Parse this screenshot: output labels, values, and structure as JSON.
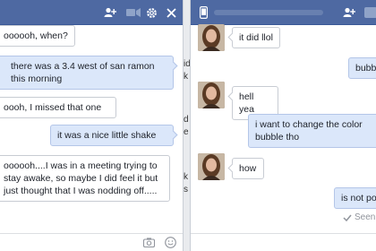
{
  "left_chat": {
    "messages": [
      {
        "side": "theirs",
        "text": "oooooh, when?"
      },
      {
        "side": "mine",
        "text": "there was a 3.4 west of san ramon this morning"
      },
      {
        "side": "theirs",
        "text": "oooh, I missed that one"
      },
      {
        "side": "mine",
        "text": "it was a nice little shake"
      },
      {
        "side": "theirs",
        "text": "oooooh....I was in a meeting trying to stay awake, so maybe I did feel it but just thought that I was nodding off....."
      }
    ]
  },
  "gap_text": [
    "id",
    "k",
    "d",
    "e",
    "k",
    "s"
  ],
  "right_chat": {
    "messages": [
      {
        "side": "theirs",
        "text": "it did llol"
      },
      {
        "side": "mine",
        "text": "bubb"
      },
      {
        "side": "theirs",
        "text": "hell yea"
      },
      {
        "side": "mine",
        "text": "i want to change the color bubble tho"
      },
      {
        "side": "theirs",
        "text": "how"
      },
      {
        "side": "mine",
        "text": "is not po"
      }
    ],
    "seen_label": "Seen"
  },
  "colors": {
    "header": "#4e69a2",
    "mine_bubble": "#dbe7fa",
    "theirs_bubble": "#ffffff"
  },
  "icons": {
    "left_header": [
      "add-friend-icon",
      "video-call-icon",
      "gear-icon",
      "close-icon"
    ],
    "right_header": [
      "mobile-phone-icon",
      "add-friend-icon"
    ],
    "left_composer": [
      "camera-icon",
      "emoji-icon"
    ],
    "seen": "checkmark-icon"
  }
}
